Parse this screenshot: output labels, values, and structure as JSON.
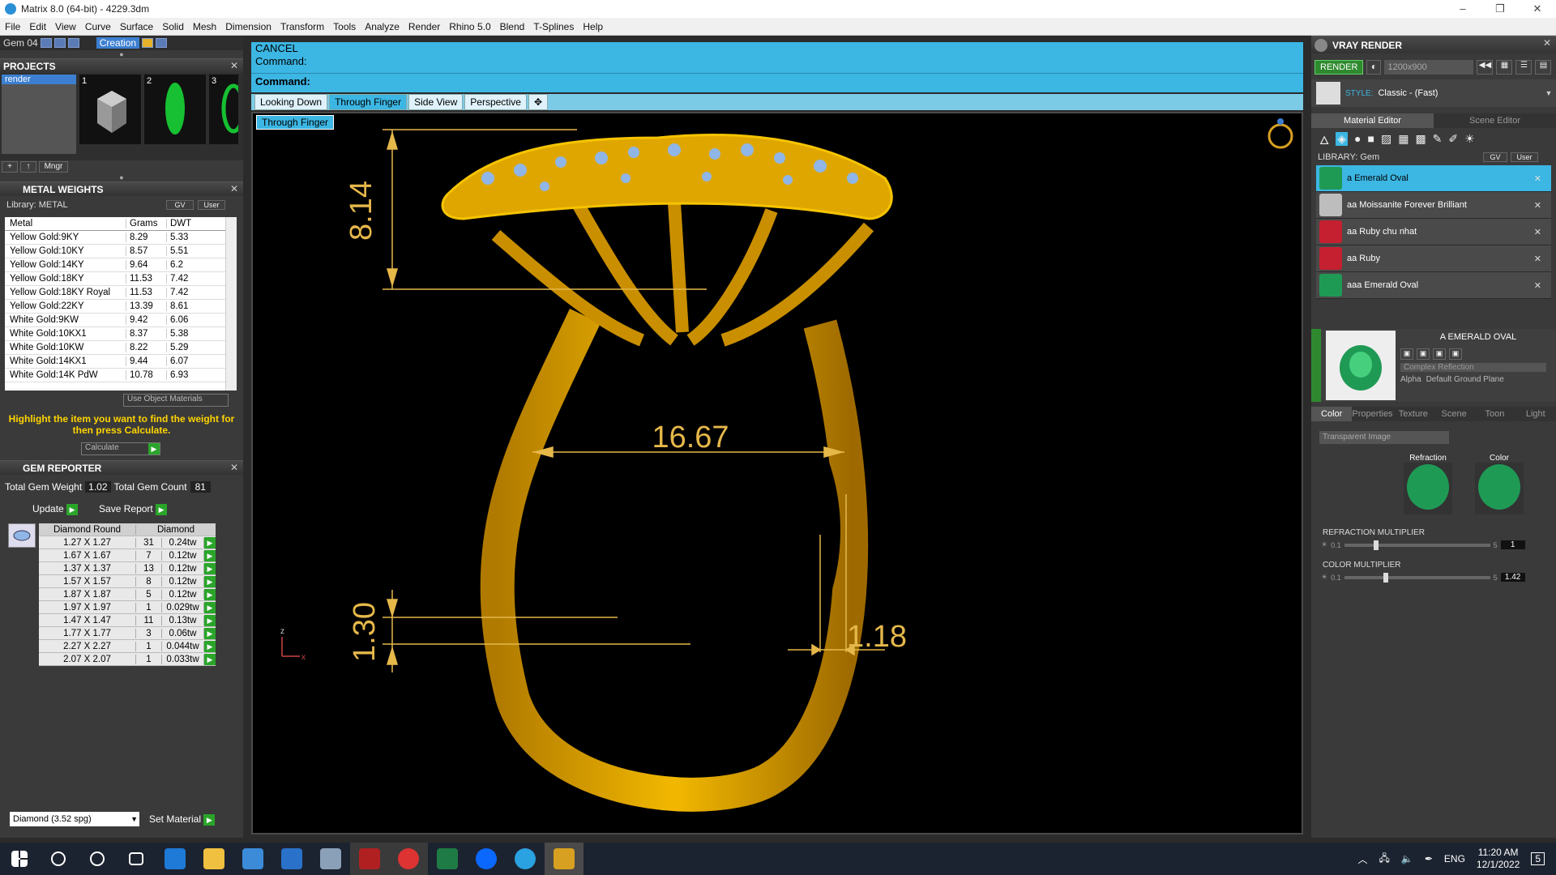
{
  "title": "Matrix 8.0 (64-bit) - 4229.3dm",
  "window_controls": [
    "–",
    "❐",
    "✕"
  ],
  "menu": [
    "File",
    "Edit",
    "View",
    "Curve",
    "Surface",
    "Solid",
    "Mesh",
    "Dimension",
    "Transform",
    "Tools",
    "Analyze",
    "Render",
    "Rhino 5.0",
    "Blend",
    "T-Splines",
    "Help"
  ],
  "gembar": {
    "gem_label": "Gem 04",
    "creation_label": "Creation"
  },
  "projects": {
    "header": "PROJECTS",
    "list_item": "render",
    "thumb_numbers": [
      "1",
      "2",
      "3"
    ],
    "mngr_label": "Mngr"
  },
  "metal_weights": {
    "header": "METAL WEIGHTS",
    "library": "Library: METAL",
    "gv_label": "GV",
    "user_label": "User",
    "columns": [
      "Metal",
      "Grams",
      "DWT"
    ],
    "rows": [
      [
        "Yellow Gold:9KY",
        "8.29",
        "5.33"
      ],
      [
        "Yellow Gold:10KY",
        "8.57",
        "5.51"
      ],
      [
        "Yellow Gold:14KY",
        "9.64",
        "6.2"
      ],
      [
        "Yellow Gold:18KY",
        "11.53",
        "7.42"
      ],
      [
        "Yellow Gold:18KY Royal",
        "11.53",
        "7.42"
      ],
      [
        "Yellow Gold:22KY",
        "13.39",
        "8.61"
      ],
      [
        "White Gold:9KW",
        "9.42",
        "6.06"
      ],
      [
        "White Gold:10KX1",
        "8.37",
        "5.38"
      ],
      [
        "White Gold:10KW",
        "8.22",
        "5.29"
      ],
      [
        "White Gold:14KX1",
        "9.44",
        "6.07"
      ],
      [
        "White Gold:14K PdW",
        "10.78",
        "6.93"
      ]
    ],
    "use_object_materials": "Use Object Materials",
    "hint": "Highlight the item you want to find the weight for then press Calculate.",
    "calculate": "Calculate"
  },
  "gem_reporter": {
    "header": "GEM REPORTER",
    "total_weight_label": "Total Gem Weight",
    "total_weight_value": "1.02",
    "total_count_label": "Total Gem Count",
    "total_count_value": "81",
    "update": "Update",
    "save_report": "Save Report",
    "columns": [
      "Diamond Round",
      "Diamond"
    ],
    "rows": [
      [
        "1.27 X 1.27",
        "31",
        "0.24tw"
      ],
      [
        "1.67 X 1.67",
        "7",
        "0.12tw"
      ],
      [
        "1.37 X 1.37",
        "13",
        "0.12tw"
      ],
      [
        "1.57 X 1.57",
        "8",
        "0.12tw"
      ],
      [
        "1.87 X 1.87",
        "5",
        "0.12tw"
      ],
      [
        "1.97 X 1.97",
        "1",
        "0.029tw"
      ],
      [
        "1.47 X 1.47",
        "11",
        "0.13tw"
      ],
      [
        "1.77 X 1.77",
        "3",
        "0.06tw"
      ],
      [
        "2.27 X 2.27",
        "1",
        "0.044tw"
      ],
      [
        "2.07 X 2.07",
        "1",
        "0.033tw"
      ]
    ],
    "material_select": "Diamond    (3.52 spg)",
    "set_material": "Set Material"
  },
  "command": {
    "line1": "CANCEL",
    "line2": "Command:",
    "prompt": "Command:"
  },
  "viewport": {
    "tabs": [
      "Looking Down",
      "Through Finger",
      "Side View",
      "Perspective"
    ],
    "active_tab": "Through Finger",
    "label": "Through Finger",
    "dims": {
      "height": "8.14",
      "width": "16.67",
      "bottom": "1.30",
      "side": "1.18"
    },
    "axis_z": "z",
    "axis_x": "x",
    "colors": {
      "gold": "#f2b800",
      "gem": "#8fb6e6",
      "dim": "#e6b84a"
    }
  },
  "vray": {
    "header": "VRAY RENDER",
    "render_btn": "RENDER",
    "resolution": "1200x900",
    "style_label": "STYLE:",
    "style_value": "Classic - (Fast)",
    "tabs": [
      "Material Editor",
      "Scene Editor"
    ],
    "library": "LIBRARY: Gem",
    "gv_label": "GV",
    "user_label": "User",
    "materials": [
      {
        "name": "a Emerald Oval",
        "color": "#1f9a55"
      },
      {
        "name": "aa Moissanite Forever Brilliant",
        "color": "#bdbdbd"
      },
      {
        "name": "aa Ruby chu nhat",
        "color": "#c42030"
      },
      {
        "name": "aa Ruby",
        "color": "#c42030"
      },
      {
        "name": "aaa Emerald Oval",
        "color": "#1f9a55"
      }
    ],
    "preview_title": "A EMERALD OVAL",
    "complex_reflection": "Complex Reflection",
    "alpha": "Alpha",
    "ground_plane": "Default Ground Plane",
    "subtabs": [
      "Color",
      "Properties",
      "Texture",
      "Scene",
      "Toon",
      "Light"
    ],
    "transparent": "Transparent Image",
    "refraction_label": "Refraction",
    "color_label": "Color",
    "refraction_mult": "REFRACTION MULTIPLIER",
    "refraction_min": "0.1",
    "refraction_max": "5",
    "refraction_value": "1",
    "color_mult": "COLOR MULTIPLIER",
    "color_min": "0.1",
    "color_max": "5",
    "color_value": "1.42"
  },
  "taskbar": {
    "language": "ENG",
    "time": "11:20 AM",
    "date": "12/1/2022",
    "notify_count": "5"
  }
}
